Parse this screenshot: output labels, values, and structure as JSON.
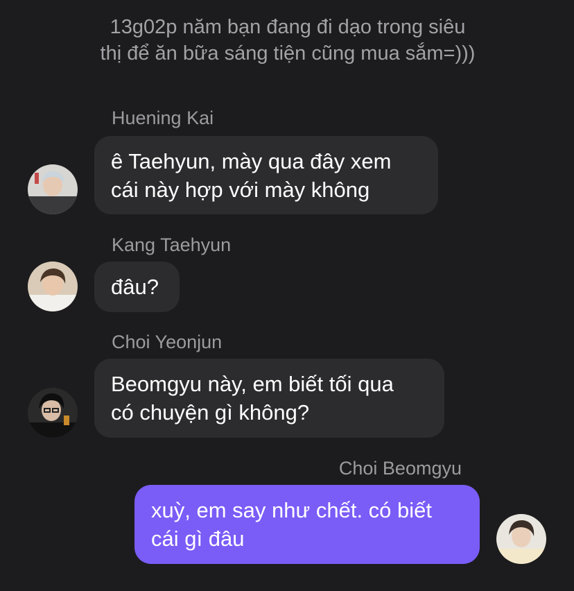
{
  "system_note": "13g02p năm bạn đang đi dạo trong siêu\nthị để ăn bữa sáng tiện cũng mua sắm=)))",
  "messages": [
    {
      "sender": "Huening Kai",
      "text": "ê Taehyun, mày qua đây xem\ncái này hợp với mày không",
      "direction": "incoming",
      "avatar_icon": "avatar-huening-kai"
    },
    {
      "sender": "Kang Taehyun",
      "text": "đâu?",
      "direction": "incoming",
      "avatar_icon": "avatar-kang-taehyun"
    },
    {
      "sender": "Choi Yeonjun",
      "text": "Beomgyu này, em biết tối qua\ncó chuyện gì không?",
      "direction": "incoming",
      "avatar_icon": "avatar-choi-yeonjun"
    },
    {
      "sender": "Choi Beomgyu",
      "text": "xuỳ, em say như chết. có biết\ncái gì đâu",
      "direction": "outgoing",
      "avatar_icon": "avatar-choi-beomgyu"
    }
  ],
  "colors": {
    "background": "#1c1c1e",
    "incoming_bubble": "#2c2c2e",
    "outgoing_bubble": "#7a5cf7",
    "sender_text": "#9b9ba0",
    "note_text": "#a2a2a7"
  }
}
